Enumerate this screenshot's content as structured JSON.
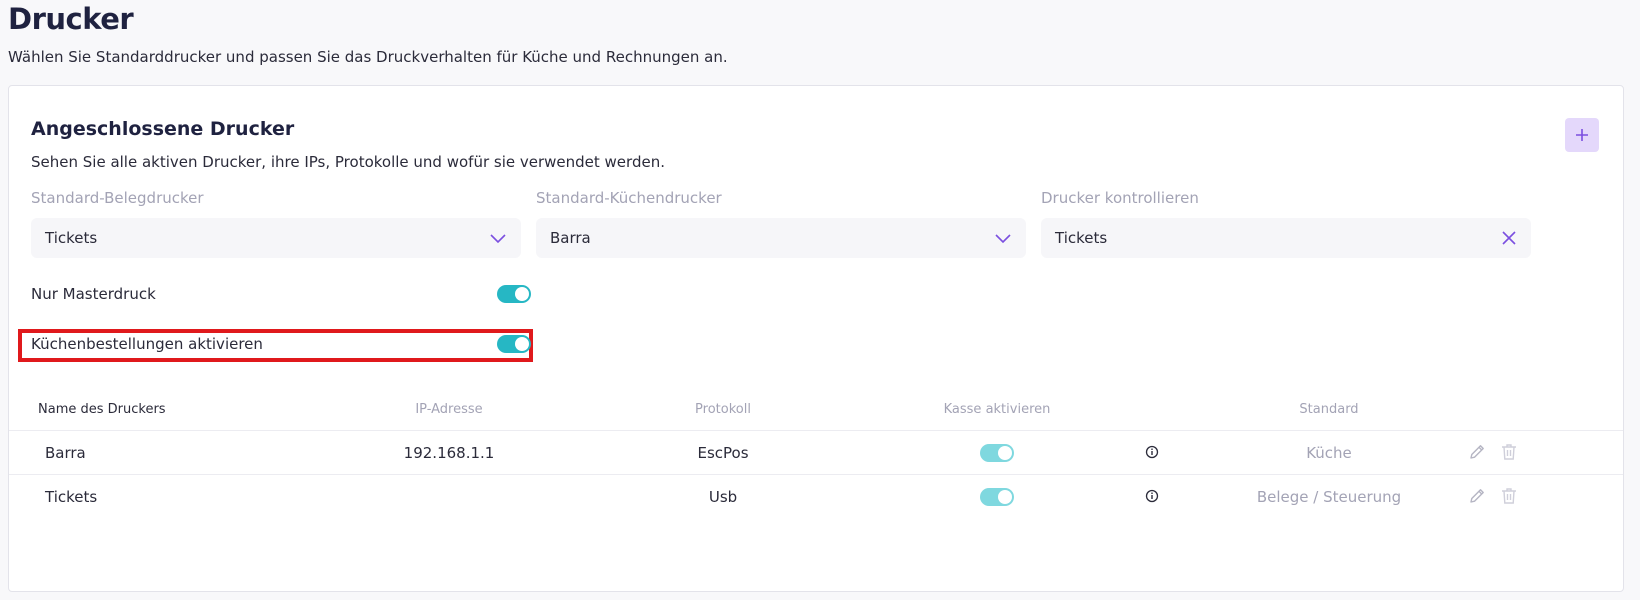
{
  "page": {
    "title": "Drucker",
    "subtitle": "Wählen Sie Standarddrucker und passen Sie das Druckverhalten für Küche und Rechnungen an."
  },
  "card": {
    "title": "Angeschlossene Drucker",
    "subtitle": "Sehen Sie alle aktiven Drucker, ihre IPs, Protokolle und wofür sie verwendet werden.",
    "add_icon": "plus-icon"
  },
  "selects": {
    "receipt": {
      "label": "Standard-Belegdrucker",
      "value": "Tickets",
      "icon": "chevron-down-icon"
    },
    "kitchen": {
      "label": "Standard-Küchendrucker",
      "value": "Barra",
      "icon": "chevron-down-icon"
    },
    "control": {
      "label": "Drucker kontrollieren",
      "value": "Tickets",
      "icon": "close-icon"
    }
  },
  "toggles": {
    "master": {
      "label": "Nur Masterdruck",
      "on": true
    },
    "kitchen_orders": {
      "label": "Küchenbestellungen aktivieren",
      "on": true
    }
  },
  "table": {
    "headers": {
      "name": "Name des Druckers",
      "ip": "IP-Adresse",
      "protocol": "Protokoll",
      "register": "Kasse aktivieren",
      "standard": "Standard"
    },
    "rows": [
      {
        "name": "Barra",
        "ip": "192.168.1.1",
        "protocol": "EscPos",
        "register_enabled": true,
        "standard": "Küche"
      },
      {
        "name": "Tickets",
        "ip": "",
        "protocol": "Usb",
        "register_enabled": true,
        "standard": "Belege / Steuerung"
      }
    ]
  },
  "colors": {
    "accent": "#7b4fe0",
    "toggle_on": "#26b7c4",
    "highlight": "#e0191c"
  }
}
